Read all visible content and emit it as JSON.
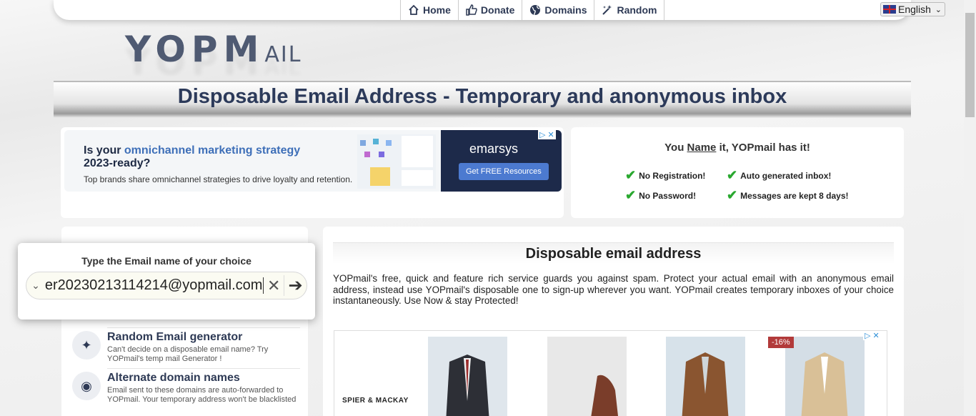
{
  "nav": {
    "items": [
      {
        "label": "Home",
        "icon": "home-icon"
      },
      {
        "label": "Donate",
        "icon": "thumbs-up-icon"
      },
      {
        "label": "Domains",
        "icon": "globe-icon"
      },
      {
        "label": "Random",
        "icon": "magic-wand-icon"
      }
    ],
    "language": "English"
  },
  "logo": {
    "main": "YOPM",
    "suffix": "AIL"
  },
  "banner_title": "Disposable Email Address - Temporary and anonymous inbox",
  "ad_top": {
    "headline_prefix": "Is your ",
    "headline_highlight": "omnichannel marketing strategy",
    "headline_suffix": "2023-ready?",
    "subtext": "Top brands share omnichannel strategies to drive loyalty and retention.",
    "brand": "emarsys",
    "cta": "Get FREE Resources"
  },
  "features": {
    "title_pre": "You ",
    "title_name": "Name",
    "title_post": " it, YOPmail has it!",
    "items": [
      "No Registration!",
      "Auto generated inbox!",
      "No Password!",
      "Messages are kept 8 days!"
    ],
    "check_color": "#2aa830"
  },
  "email_box": {
    "label": "Type the Email name of your choice",
    "value": "er20230213114214@yopmail.com"
  },
  "side_items": [
    {
      "title": "Random Email generator",
      "desc": "Can't decide on a disposable email name? Try YOPmail's temp mail Generator !",
      "icon": "magic-wand-icon"
    },
    {
      "title": "Alternate domain names",
      "desc": "Email sent to these domains are auto-forwarded to YOPmail. Your temporary address won't be blacklisted",
      "icon": "globe-icon"
    }
  ],
  "main": {
    "heading": "Disposable email address",
    "paragraph": "YOPmail's free, quick and feature rich service guards you against spam. Protect your actual email with an anonymous email address, instead use YOPmail's disposable one to sign-up wherever you want. YOPmail creates temporary inboxes of your choice instantaneously. Use Now & stay Protected!"
  },
  "ad_products": {
    "store": "SPIER & MACKAY",
    "discount": "-16%"
  }
}
